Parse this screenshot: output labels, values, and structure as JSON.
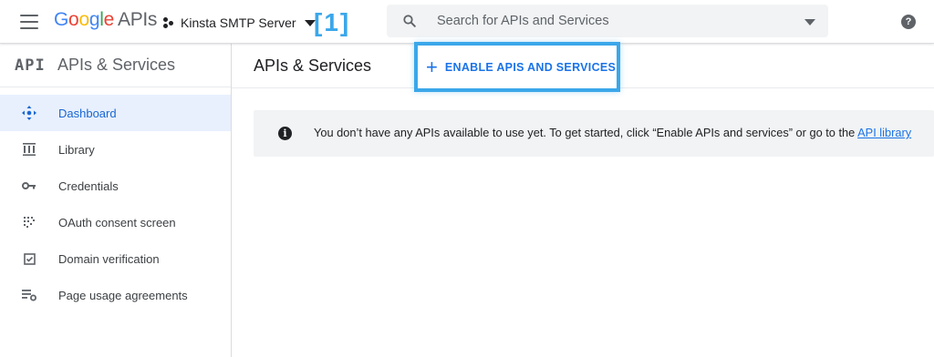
{
  "topbar": {
    "logo_google": [
      "G",
      "o",
      "o",
      "g",
      "l",
      "e"
    ],
    "logo_suffix": "APIs",
    "project_name": "Kinsta SMTP Server",
    "annotation": "[1]",
    "search": {
      "placeholder": "Search for APIs and Services",
      "value": ""
    },
    "icons": [
      "menu-icon",
      "project-icon",
      "chevron-down-icon",
      "search-icon",
      "help-icon"
    ],
    "help_glyph": "?"
  },
  "sidebar": {
    "api_glyph": "API",
    "title": "APIs & Services",
    "items": [
      {
        "label": "Dashboard",
        "icon": "dashboard-icon",
        "active": true
      },
      {
        "label": "Library",
        "icon": "library-icon",
        "active": false
      },
      {
        "label": "Credentials",
        "icon": "key-icon",
        "active": false
      },
      {
        "label": "OAuth consent screen",
        "icon": "oauth-icon",
        "active": false
      },
      {
        "label": "Domain verification",
        "icon": "checkbox-icon",
        "active": false
      },
      {
        "label": "Page usage agreements",
        "icon": "settings-list-icon",
        "active": false
      }
    ]
  },
  "main": {
    "title": "APIs & Services",
    "enable_button": {
      "plus": "+",
      "label": "ENABLE APIS AND SERVICES"
    },
    "info": {
      "glyph": "i",
      "text": "You don’t have any APIs available to use yet. To get started, click “Enable APIs and services” or go to the ",
      "link": "API library"
    }
  },
  "colors": {
    "accent_blue": "#1a73e8",
    "active_nav_bg": "#e8f0fe",
    "annotation_highlight": "#3ba7ea",
    "banner_bg": "#f1f3f4"
  }
}
